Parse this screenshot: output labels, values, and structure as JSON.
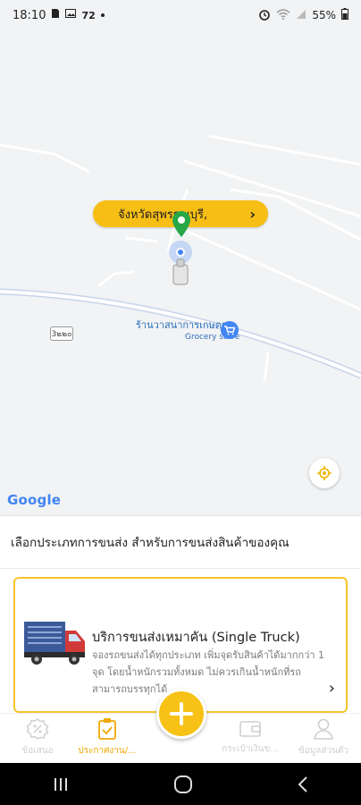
{
  "status_bar": {
    "time": "18:10",
    "notif_count": "72",
    "battery": "55%"
  },
  "map": {
    "province_label": "จังหวัดสุพรรณบุรี,",
    "road_number": "3๒๒๐",
    "poi_name": "ร้านวาสนาการเกษตร",
    "poi_type": "Grocery store",
    "google_logo": "Google"
  },
  "prompt": {
    "text": "เลือกประเภทการขนส่ง สำหรับการขนส่งสินค้าของคุณ"
  },
  "service_card": {
    "title": "บริการขนส่งเหมาคัน (Single Truck)",
    "description": "จองรถขนส่งได้ทุกประเภท เพิ่มจุดรับสินค้าได้มากกว่า 1 จุด โดยน้ำหนักรวมทั้งหมด ไม่ควรเกินน้ำหนักที่รถสามารถบรรทุกได้"
  },
  "bottom_nav": {
    "items": [
      {
        "label": "ข้อเสนอ",
        "icon": "percent-icon"
      },
      {
        "label": "ประกาศงาน/...",
        "icon": "clipboard-check-icon"
      },
      {
        "label": "กระเป๋าเงินข...",
        "icon": "wallet-icon"
      },
      {
        "label": "ข้อมูลส่วนตัว",
        "icon": "person-icon"
      }
    ],
    "fab_icon": "plus-icon"
  },
  "colors": {
    "accent": "#f7c215",
    "active_label": "#f0a800",
    "inactive": "#cfcfcf",
    "link_blue": "#2a6dbb"
  }
}
